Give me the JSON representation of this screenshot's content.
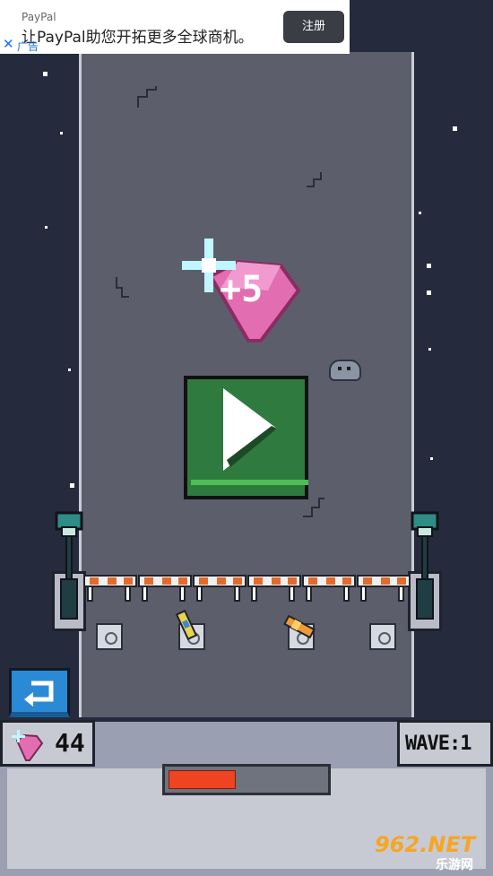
{
  "ad": {
    "brand": "PayPal",
    "text": "让PayPal助您开拓更多全球商机。",
    "cta": "注册",
    "tag": "广告"
  },
  "bonus": {
    "label": "+5"
  },
  "hud": {
    "gems": "44",
    "wave": "WAVE:1",
    "health_fraction": 0.43
  },
  "watermark": {
    "main": "962.NET",
    "sub": "乐游网"
  },
  "colors": {
    "play_green": "#2f7a3e",
    "gem_pink": "#e26db0",
    "health_red": "#ee4422",
    "back_blue": "#2b8ad6"
  },
  "icons": {
    "play": "play-triangle-icon",
    "back": "return-arrow-icon",
    "gem": "pink-gem-icon",
    "close": "close-x-icon"
  }
}
